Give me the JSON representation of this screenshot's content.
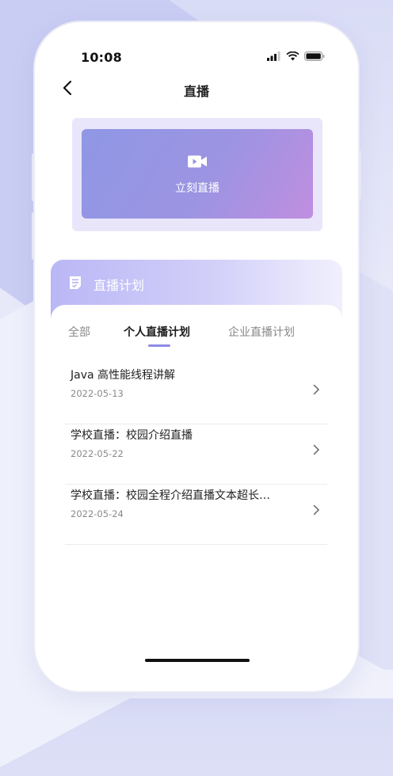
{
  "status": {
    "time": "10:08"
  },
  "nav": {
    "title": "直播",
    "back_icon": "chevron-left-icon"
  },
  "live_banner": {
    "label": "立刻直播",
    "icon": "video-camera-icon"
  },
  "plan": {
    "title": "直播计划",
    "icon": "document-icon",
    "tabs": [
      {
        "label": "全部",
        "active": false
      },
      {
        "label": "个人直播计划",
        "active": true
      },
      {
        "label": "企业直播计划",
        "active": false
      }
    ],
    "items": [
      {
        "title": "Java 高性能线程讲解",
        "date": "2022-05-13"
      },
      {
        "title": "学校直播：校园介绍直播",
        "date": "2022-05-22"
      },
      {
        "title": "学校直播：校园全程介绍直播文本超长…",
        "date": "2022-05-24"
      }
    ]
  },
  "colors": {
    "accent": "#8d8ae6",
    "banner_gradient_start": "#8f97e5",
    "banner_gradient_end": "#c08ee0"
  }
}
